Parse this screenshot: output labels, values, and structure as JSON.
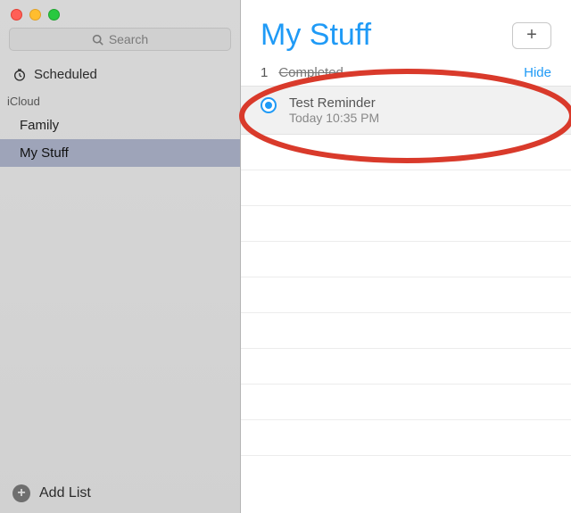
{
  "window": {
    "search_placeholder": "Search",
    "scheduled_label": "Scheduled",
    "section_label": "iCloud",
    "lists": [
      {
        "label": "Family",
        "selected": false
      },
      {
        "label": "My Stuff",
        "selected": true
      }
    ],
    "add_list_label": "Add List"
  },
  "main": {
    "title": "My Stuff",
    "completed_count": "1",
    "completed_label": "Completed",
    "hide_label": "Hide",
    "reminder": {
      "title": "Test Reminder",
      "subtitle": "Today 10:35 PM",
      "completed": true
    }
  },
  "colors": {
    "accent": "#1f9af6"
  }
}
